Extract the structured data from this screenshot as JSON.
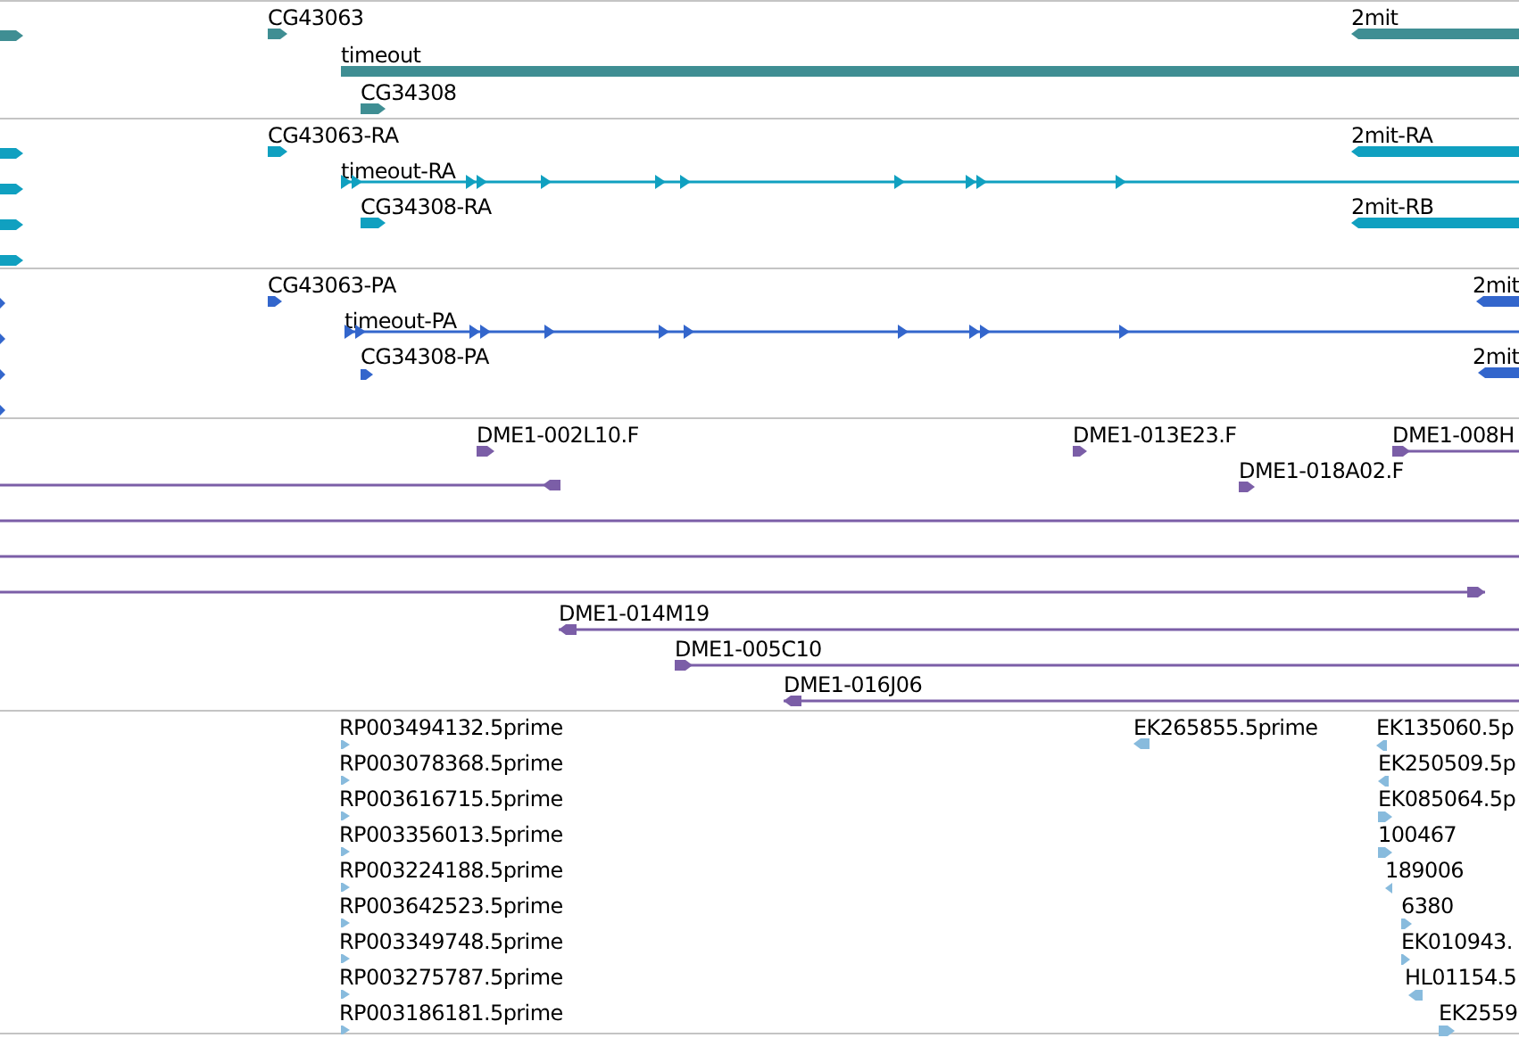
{
  "tracks": [
    {
      "color": "#3f8e93",
      "features": [
        {
          "label": "CG43063",
          "reverse": false
        },
        {
          "label": "timeout"
        },
        {
          "label": "CG34308",
          "reverse": false
        },
        {
          "label": "2mit",
          "reverse": true
        }
      ]
    },
    {
      "color": "#10a0c0",
      "features": [
        {
          "label": "CG43063-RA",
          "reverse": false
        },
        {
          "label": "timeout-RA",
          "reverse": false
        },
        {
          "label": "CG34308-RA",
          "reverse": false
        },
        {
          "label": "2mit-RA",
          "reverse": true
        },
        {
          "label": "2mit-RB",
          "reverse": true
        }
      ]
    },
    {
      "color": "#3366cc",
      "features": [
        {
          "label": "CG43063-PA",
          "reverse": false
        },
        {
          "label": "timeout-PA",
          "reverse": false
        },
        {
          "label": "CG34308-PA",
          "reverse": false
        },
        {
          "label": "2mit",
          "reverse": true
        },
        {
          "label": "2mit",
          "reverse": true
        }
      ]
    },
    {
      "color": "#7b5ea7",
      "features": [
        {
          "label": "DME1-002L10.F",
          "reverse": false
        },
        {
          "label": "DME1-013E23.F",
          "reverse": false
        },
        {
          "label": "DME1-008H",
          "reverse": false
        },
        {
          "label": "DME1-018A02.F",
          "reverse": false
        },
        {
          "label": "DME1-014M19",
          "reverse": true
        },
        {
          "label": "DME1-005C10",
          "reverse": false
        },
        {
          "label": "DME1-016J06",
          "reverse": true
        }
      ]
    },
    {
      "color": "#88bbdd",
      "features": [
        {
          "label": "RP003494132.5prime",
          "reverse": false
        },
        {
          "label": "RP003078368.5prime",
          "reverse": false
        },
        {
          "label": "RP003616715.5prime",
          "reverse": false
        },
        {
          "label": "RP003356013.5prime",
          "reverse": false
        },
        {
          "label": "RP003224188.5prime",
          "reverse": false
        },
        {
          "label": "RP003642523.5prime",
          "reverse": false
        },
        {
          "label": "RP003349748.5prime",
          "reverse": false
        },
        {
          "label": "RP003275787.5prime",
          "reverse": false
        },
        {
          "label": "RP003186181.5prime",
          "reverse": false
        },
        {
          "label": "EK265855.5prime",
          "reverse": true
        },
        {
          "label": "EK135060.5p",
          "reverse": true
        },
        {
          "label": "EK250509.5p",
          "reverse": true
        },
        {
          "label": "EK085064.5p",
          "reverse": false
        },
        {
          "label": "100467",
          "reverse": false
        },
        {
          "label": "189006",
          "reverse": true
        },
        {
          "label": "6380",
          "reverse": false
        },
        {
          "label": "EK010943.",
          "reverse": false
        },
        {
          "label": "HL01154.5",
          "reverse": true
        },
        {
          "label": "EK2559",
          "reverse": false
        }
      ]
    }
  ]
}
